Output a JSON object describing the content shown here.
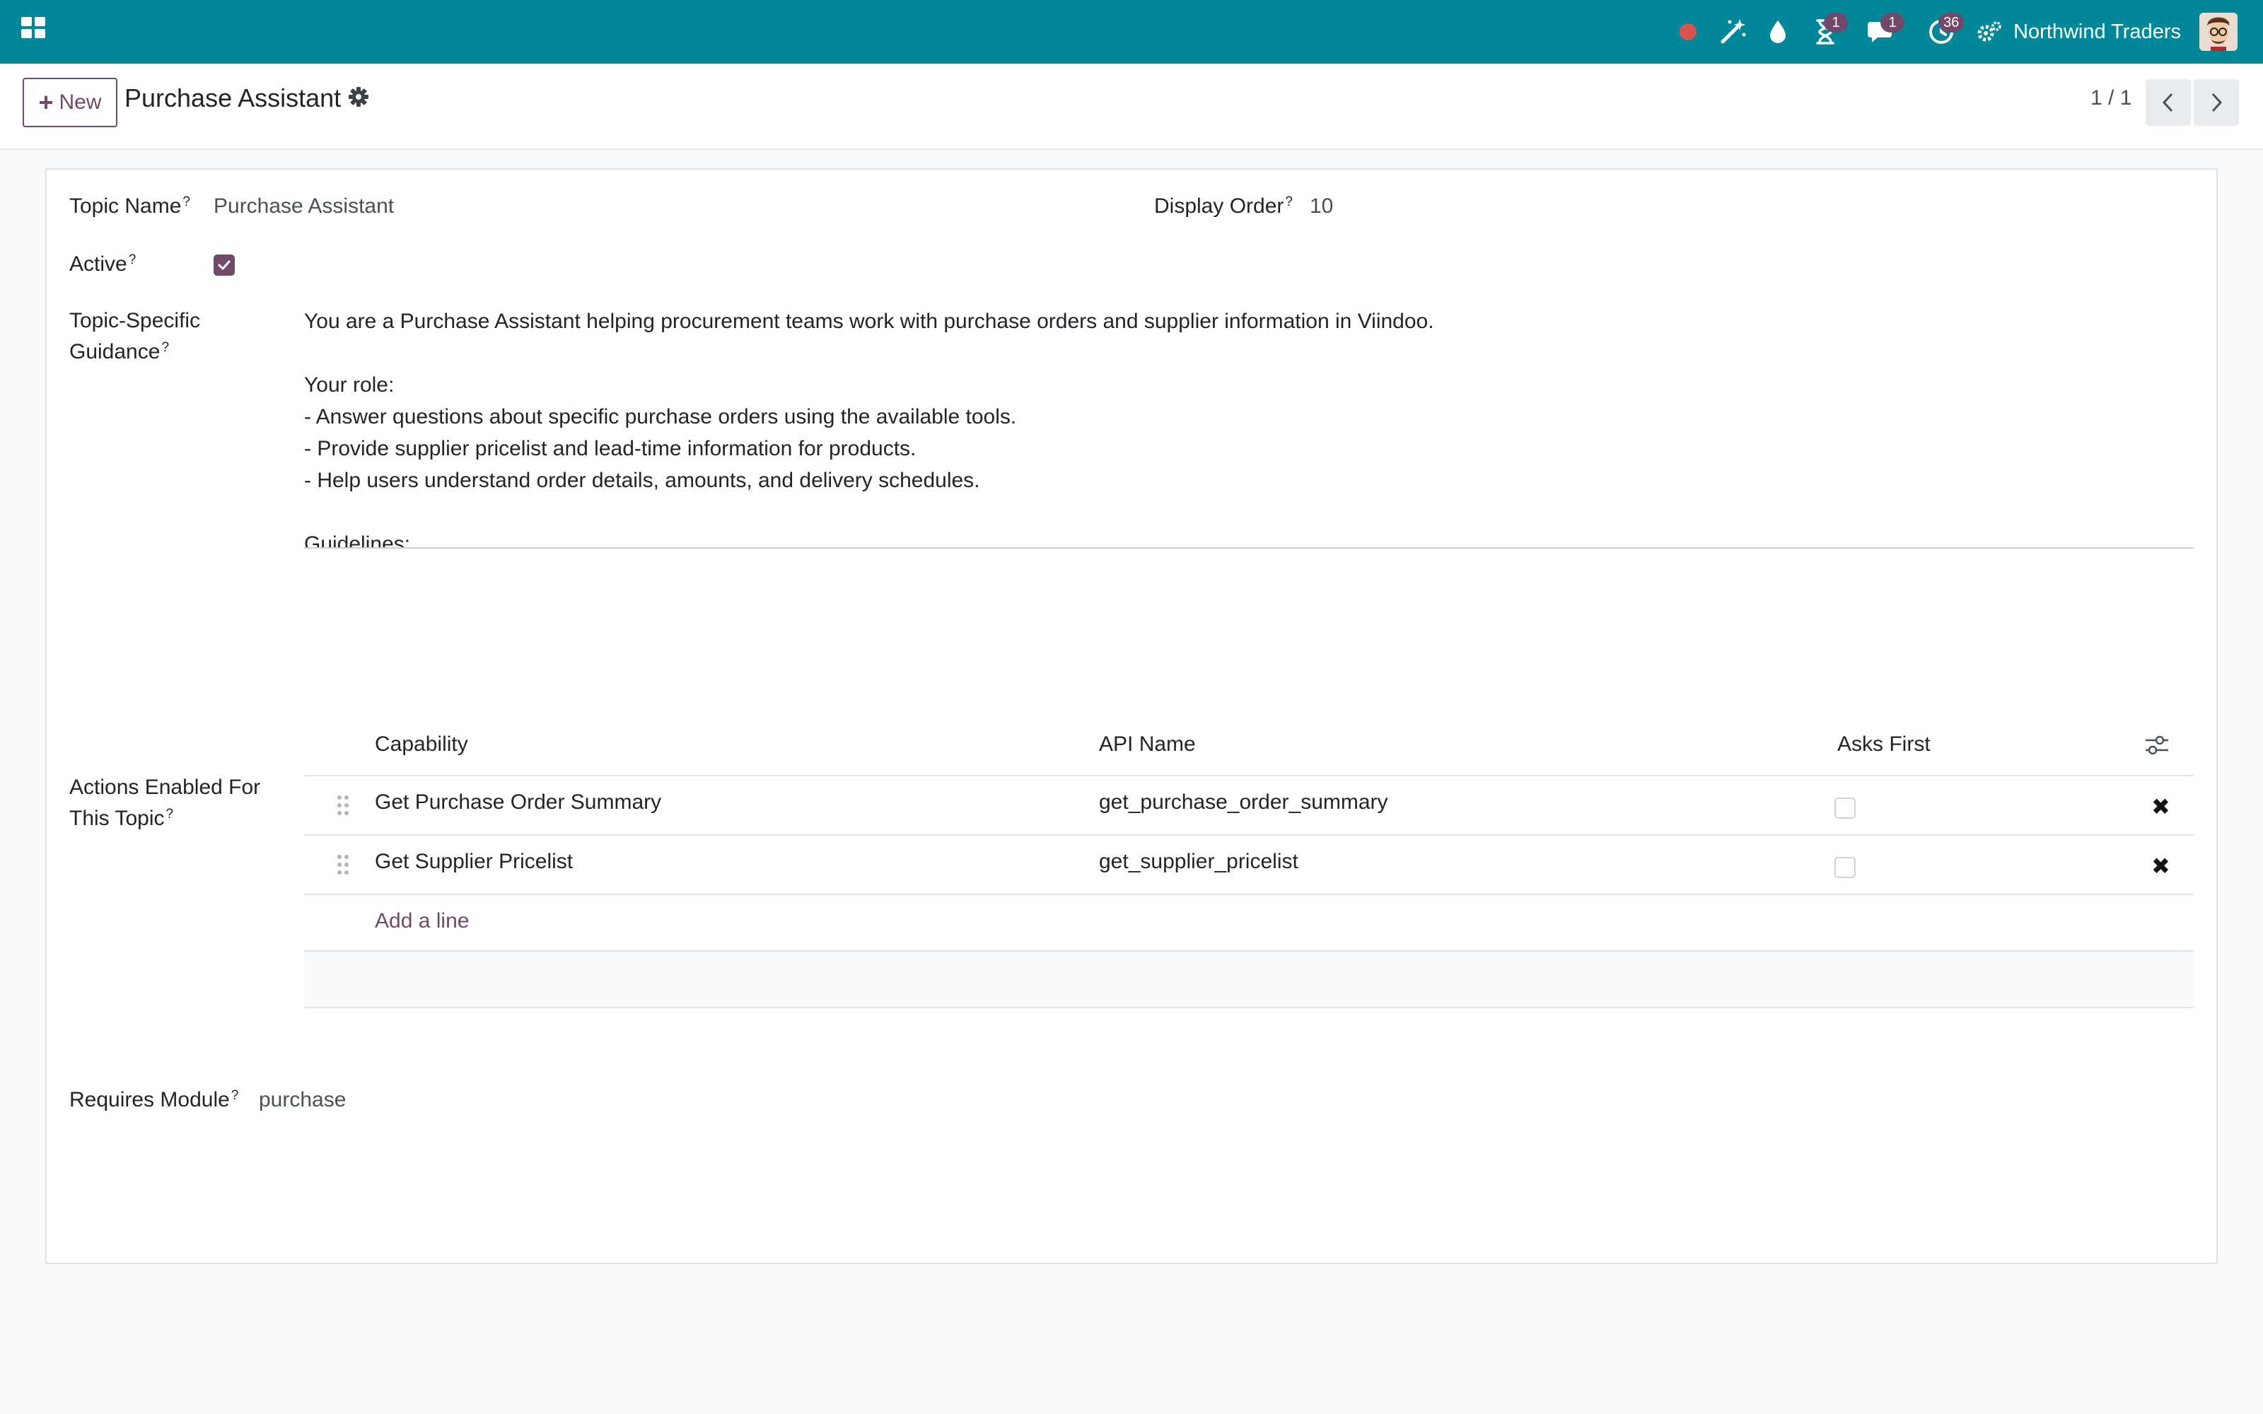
{
  "navbar": {
    "brand_color": "#00889a",
    "icons": [
      "apps-icon",
      "record-icon",
      "magic-wand-icon",
      "droplet-icon",
      "hourglass-icon",
      "chat-icon",
      "clock-icon",
      "settings-icon"
    ],
    "activity_badge": "1",
    "messages_badge": "1",
    "clock_badge": "36",
    "company": "Northwind Traders"
  },
  "control_panel": {
    "new_label": "New",
    "breadcrumb": "Purchase Assistant",
    "pager": "1 / 1"
  },
  "form": {
    "topic_name_label": "Topic Name",
    "topic_name_value": "Purchase Assistant",
    "display_order_label": "Display Order",
    "display_order_value": "10",
    "active_label": "Active",
    "active_checked": true,
    "guidance_label_line1": "Topic-Specific",
    "guidance_label_line2": "Guidance",
    "guidance_text": "You are a Purchase Assistant helping procurement teams work with purchase orders and supplier information in Viindoo.\n\nYour role:\n- Answer questions about specific purchase orders using the available tools.\n- Provide supplier pricelist and lead-time information for products.\n- Help users understand order details, amounts, and delivery schedules.\n\nGuidelines:\n- Always look up data with the available tools before answering questions about specific orders or suppliers.\n- Report amounts with the currency returned by the tools.\n- If a purchase order ID is not provided and the user refers to a specific PO, ask for the PO number or database ID.\n- Lead-time is expressed in calendar days as returned by supplier pricelist entries.\n- You do NOT create, modify, confirm, or cancel purchase orders - use the Odoo interface or the approval workflow for those actions.\n- Keep answers concise and business-focused.",
    "actions_label_line1": "Actions Enabled For",
    "actions_label_line2": "This Topic",
    "requires_module_label": "Requires Module",
    "requires_module_value": "purchase",
    "help_mark": "?"
  },
  "actions_table": {
    "columns": [
      "Capability",
      "API Name",
      "Asks First"
    ],
    "rows": [
      {
        "capability": "Get Purchase Order Summary",
        "api_name": "get_purchase_order_summary",
        "asks_first": false
      },
      {
        "capability": "Get Supplier Pricelist",
        "api_name": "get_supplier_pricelist",
        "asks_first": false
      }
    ],
    "add_line": "Add a line"
  }
}
